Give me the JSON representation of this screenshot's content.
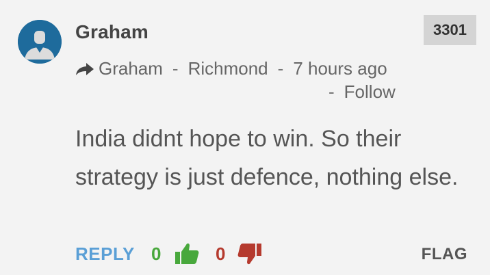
{
  "comment": {
    "author": "Graham",
    "score": "3301",
    "meta": {
      "reply_to": "Graham",
      "location": "Richmond",
      "time_ago": "7 hours ago",
      "separator": "-",
      "follow_label": "Follow"
    },
    "text": "India didnt hope to win. So their strategy is just defence, nothing else.",
    "actions": {
      "reply_label": "REPLY",
      "upvotes": "0",
      "downvotes": "0",
      "flag_label": "FLAG"
    }
  },
  "colors": {
    "avatar_bg": "#1e6b9c",
    "reply": "#5a9fd6",
    "upvote": "#48a83c",
    "downvote": "#b53a2e",
    "score_bg": "#d4d4d4"
  },
  "icons": {
    "avatar": "default-user-avatar-icon",
    "reply_arrow": "reply-arrow-icon",
    "thumbs_up": "thumbs-up-icon",
    "thumbs_down": "thumbs-down-icon"
  }
}
